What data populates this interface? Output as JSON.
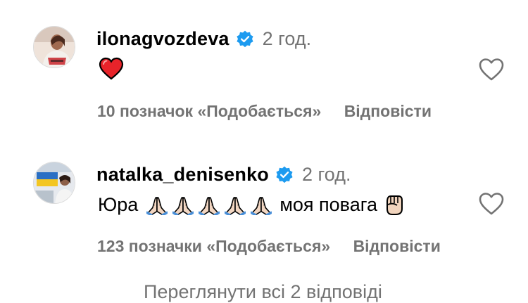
{
  "colors": {
    "verified": "#1d9bf0",
    "heart": "#e8232a",
    "muted": "#737373"
  },
  "comments": [
    {
      "username": "ilonagvozdeva",
      "verified_icon": "verified-badge-icon",
      "time": "2 год.",
      "text": "",
      "emoji": [
        "red-heart"
      ],
      "likes_label": "10 позначок «Подобається»",
      "reply_label": "Відповісти",
      "like_icon": "heart-outline-icon"
    },
    {
      "username": "natalka_denisenko",
      "verified_icon": "verified-badge-icon",
      "time": "2 год.",
      "text": "Юра",
      "emoji": [
        "folded-hands",
        "folded-hands",
        "folded-hands",
        "folded-hands",
        "folded-hands"
      ],
      "text_after": "моя повага",
      "emoji_after": "raised-fist",
      "likes_label": "123 позначки «Подобається»",
      "reply_label": "Відповісти",
      "like_icon": "heart-outline-icon"
    }
  ],
  "view_more": "Переглянути всі 2 відповіді"
}
